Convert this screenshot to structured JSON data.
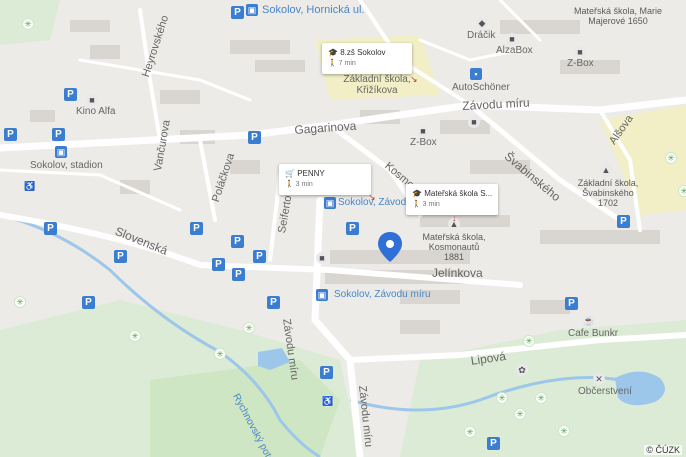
{
  "places": {
    "hornicka": "Sokolov, Hornická ul.",
    "heyrovskeho": "Heyrovského",
    "kino": "Kino Alfa",
    "vancurova": "Vančurova",
    "gagarinova": "Gagarinova",
    "stadion": "Sokolov, stadion",
    "polackova": "Poláčkova",
    "slovenska": "Slovenská",
    "seifertova": "Seifertova",
    "zavodu_miru_v1": "Závodu míru",
    "zavodu_miru_v2": "Závodu míru",
    "zavodu_miru_h": "Závodu míru",
    "stop_zavodu_top": "Sokolov, Závodu míru",
    "stop_zavodu_bottom": "Sokolov, Závodu míru",
    "kosmonautu": "Kosmo",
    "jelinkova": "Jelínkova",
    "zs_name": "Základní škola, Křižíkova",
    "dracik": "Dráčik",
    "alzabox": "AlzaBox",
    "zbox1": "Z-Box",
    "zbox2": "Z-Box",
    "autoschoner": "AutoSchöner",
    "ms_majerove": "Mateřská škola, Marie Majerové 1650",
    "svabinskeho": "Švabinského",
    "alsova": "Alšova",
    "zs_svab": "Základní škola, Švabinského 1702",
    "ms_kosmo": "Mateřská škola, Kosmonautů 1881",
    "lipova": "Lipová",
    "cafe": "Cafe Bunkr",
    "obcerstveni": "Občerstvení",
    "rychnovsky": "Rychnovský potok"
  },
  "cards": [
    {
      "title": "8.zš Sokolov",
      "walk": "7 min",
      "icon": "school-icon"
    },
    {
      "title": "PENNY",
      "walk": "3 min",
      "icon": "cart-icon"
    },
    {
      "title": "Mateřská škola S...",
      "walk": "3 min",
      "icon": "school-icon"
    }
  ],
  "copyright": "© ČÚZK",
  "parking_label": "P",
  "colors": {
    "pin": "#2f6fd6",
    "parking": "#3a7dd1",
    "park": "#cfe6c4",
    "school_area": "#f2efc6",
    "water": "#9cc7ea"
  }
}
